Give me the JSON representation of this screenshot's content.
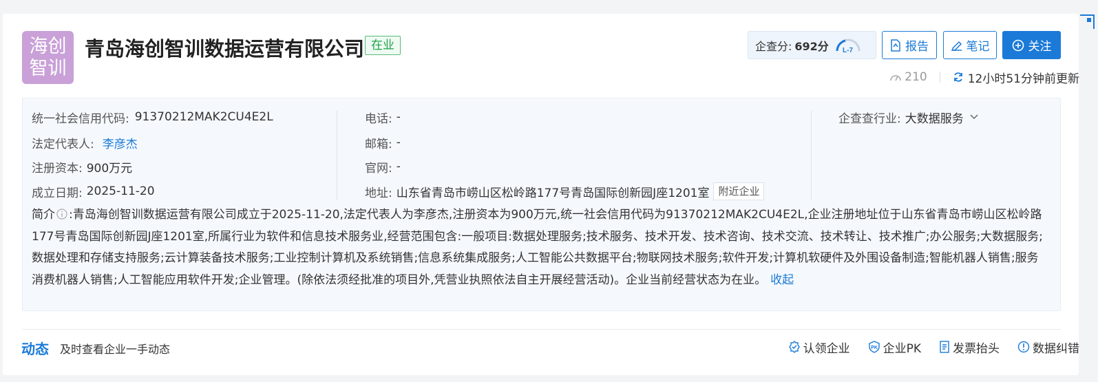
{
  "company": {
    "logo_text": "海创\n智训",
    "name": "青岛海创智训数据运营有限公司",
    "status": "在业"
  },
  "score": {
    "label": "企查分:",
    "value": "692分",
    "level": "L-7"
  },
  "buttons": {
    "report": "报告",
    "notes": "笔记",
    "follow": "关注"
  },
  "meta": {
    "views": "210",
    "updated": "12小时51分钟前更新"
  },
  "info": {
    "credit_code_label": "统一社会信用代码:",
    "credit_code": "91370212MAK2CU4E2L",
    "legal_rep_label": "法定代表人:",
    "legal_rep": "李彦杰",
    "capital_label": "注册资本:",
    "capital": "900万元",
    "founded_label": "成立日期:",
    "founded": "2025-11-20",
    "phone_label": "电话:",
    "phone": "-",
    "email_label": "邮箱:",
    "email": "-",
    "website_label": "官网:",
    "website": "-",
    "address_label": "地址:",
    "address": "山东省青岛市崂山区松岭路177号青岛国际创新园J座1201室",
    "nearby": "附近企业",
    "industry_label": "企查查行业:",
    "industry": "大数据服务"
  },
  "intro": {
    "label": "简介",
    "text": ":青岛海创智训数据运营有限公司成立于2025-11-20,法定代表人为李彦杰,注册资本为900万元,统一社会信用代码为91370212MAK2CU4E2L,企业注册地址位于山东省青岛市崂山区松岭路177号青岛国际创新园J座1201室,所属行业为软件和信息技术服务业,经营范围包含:一般项目:数据处理服务;技术服务、技术开发、技术咨询、技术交流、技术转让、技术推广;办公服务;大数据服务;数据处理和存储支持服务;云计算装备技术服务;工业控制计算机及系统销售;信息系统集成服务;人工智能公共数据平台;物联网技术服务;软件开发;计算机软硬件及外围设备制造;智能机器人销售;服务消费机器人销售;人工智能应用软件开发;企业管理。(除依法须经批准的项目外,凭营业执照依法自主开展经营活动)。企业当前经营状态为在业。",
    "collapse": "收起"
  },
  "dynamics": {
    "title": "动态",
    "subtitle": "及时查看企业一手动态"
  },
  "actions": {
    "claim": "认领企业",
    "pk": "企业PK",
    "invoice": "发票抬头",
    "correction": "数据纠错"
  },
  "colors": {
    "brand": "#1b7ad8",
    "status_green": "#1fa24a",
    "logo_bg": "#c9a0d8"
  }
}
